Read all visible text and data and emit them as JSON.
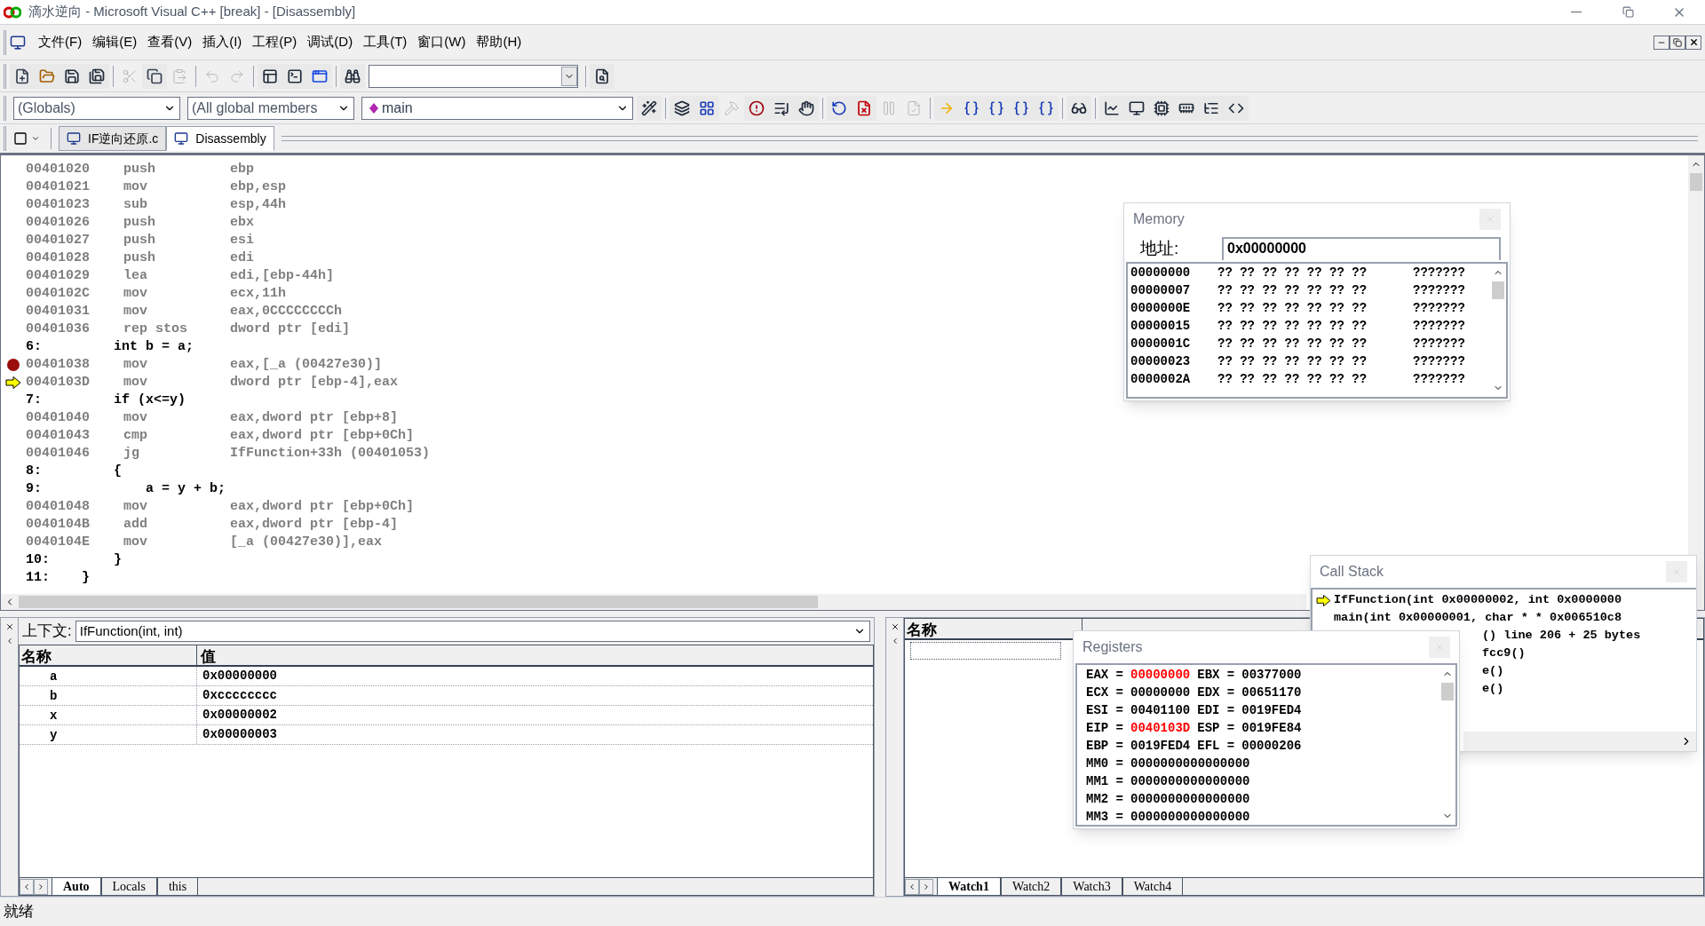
{
  "window": {
    "title": "滴水逆向 - Microsoft Visual C++ [break] - [Disassembly]"
  },
  "menu": [
    "文件(F)",
    "编辑(E)",
    "查看(V)",
    "插入(I)",
    "工程(P)",
    "调试(D)",
    "工具(T)",
    "窗口(W)",
    "帮助(H)"
  ],
  "toolbar_1": [
    {
      "kind": "new",
      "disabled": false
    },
    {
      "kind": "open",
      "disabled": false
    },
    {
      "kind": "save",
      "disabled": false
    },
    {
      "kind": "save-all",
      "disabled": false
    },
    {
      "kind": "sep"
    },
    {
      "kind": "cut",
      "disabled": true
    },
    {
      "kind": "copy",
      "disabled": false
    },
    {
      "kind": "paste",
      "disabled": true
    },
    {
      "kind": "sep"
    },
    {
      "kind": "undo",
      "disabled": true
    },
    {
      "kind": "redo",
      "disabled": true
    },
    {
      "kind": "sep"
    },
    {
      "kind": "workspace",
      "disabled": false
    },
    {
      "kind": "output",
      "disabled": false
    },
    {
      "kind": "windows",
      "disabled": false
    },
    {
      "kind": "sep"
    },
    {
      "kind": "find-files",
      "disabled": false
    },
    {
      "kind": "find-combo"
    },
    {
      "kind": "sep"
    },
    {
      "kind": "help-search",
      "disabled": false
    }
  ],
  "class_combo": {
    "value": "(Globals)"
  },
  "members_combo": {
    "value": "(All global members"
  },
  "function_combo": {
    "value": "main"
  },
  "toolbar_2": [
    {
      "kind": "wizard",
      "disabled": false
    },
    {
      "kind": "sep"
    },
    {
      "kind": "compile",
      "disabled": false
    },
    {
      "kind": "build",
      "disabled": false
    },
    {
      "kind": "stop",
      "disabled": true
    },
    {
      "kind": "execute",
      "disabled": false
    },
    {
      "kind": "breakpoint-list",
      "disabled": false
    },
    {
      "kind": "hand",
      "disabled": false
    },
    {
      "kind": "sep"
    },
    {
      "kind": "restart",
      "disabled": false
    },
    {
      "kind": "stop-debug",
      "disabled": false
    },
    {
      "kind": "break",
      "disabled": true
    },
    {
      "kind": "apply",
      "disabled": true
    },
    {
      "kind": "sep"
    },
    {
      "kind": "show-next",
      "disabled": false
    },
    {
      "kind": "step-into",
      "disabled": false
    },
    {
      "kind": "step-over",
      "disabled": false
    },
    {
      "kind": "step-out",
      "disabled": false
    },
    {
      "kind": "run-cursor",
      "disabled": false
    },
    {
      "kind": "sep"
    },
    {
      "kind": "quickwatch",
      "disabled": false
    },
    {
      "kind": "sep"
    },
    {
      "kind": "watch",
      "disabled": false
    },
    {
      "kind": "variables",
      "disabled": false
    },
    {
      "kind": "registers",
      "disabled": false
    },
    {
      "kind": "memory",
      "disabled": false
    },
    {
      "kind": "callstack",
      "disabled": false
    },
    {
      "kind": "disassembly",
      "disabled": false
    }
  ],
  "document_tabs": [
    {
      "label": "IF逆向还原.c",
      "selected": false
    },
    {
      "label": "Disassembly",
      "selected": true
    }
  ],
  "code_lines": [
    {
      "kind": "asm",
      "address": "00401020",
      "mnemonic": "push",
      "operands": "ebp",
      "breakpoint": false,
      "current": false
    },
    {
      "kind": "asm",
      "address": "00401021",
      "mnemonic": "mov",
      "operands": "ebp,esp",
      "breakpoint": false,
      "current": false
    },
    {
      "kind": "asm",
      "address": "00401023",
      "mnemonic": "sub",
      "operands": "esp,44h",
      "breakpoint": false,
      "current": false
    },
    {
      "kind": "asm",
      "address": "00401026",
      "mnemonic": "push",
      "operands": "ebx",
      "breakpoint": false,
      "current": false
    },
    {
      "kind": "asm",
      "address": "00401027",
      "mnemonic": "push",
      "operands": "esi",
      "breakpoint": false,
      "current": false
    },
    {
      "kind": "asm",
      "address": "00401028",
      "mnemonic": "push",
      "operands": "edi",
      "breakpoint": false,
      "current": false
    },
    {
      "kind": "asm",
      "address": "00401029",
      "mnemonic": "lea",
      "operands": "edi,[ebp-44h]",
      "breakpoint": false,
      "current": false
    },
    {
      "kind": "asm",
      "address": "0040102C",
      "mnemonic": "mov",
      "operands": "ecx,11h",
      "breakpoint": false,
      "current": false
    },
    {
      "kind": "asm",
      "address": "00401031",
      "mnemonic": "mov",
      "operands": "eax,0CCCCCCCCh",
      "breakpoint": false,
      "current": false
    },
    {
      "kind": "asm",
      "address": "00401036",
      "mnemonic": "rep stos",
      "operands": "dword ptr [edi]",
      "breakpoint": false,
      "current": false
    },
    {
      "kind": "source",
      "text": "6:         int b = a;"
    },
    {
      "kind": "asm",
      "address": "00401038",
      "mnemonic": "mov",
      "operands": "eax,[_a (00427e30)]",
      "breakpoint": true,
      "current": false
    },
    {
      "kind": "asm",
      "address": "0040103D",
      "mnemonic": "mov",
      "operands": "dword ptr [ebp-4],eax",
      "breakpoint": false,
      "current": true
    },
    {
      "kind": "source",
      "text": "7:         if (x<=y)"
    },
    {
      "kind": "asm",
      "address": "00401040",
      "mnemonic": "mov",
      "operands": "eax,dword ptr [ebp+8]",
      "breakpoint": false,
      "current": false
    },
    {
      "kind": "asm",
      "address": "00401043",
      "mnemonic": "cmp",
      "operands": "eax,dword ptr [ebp+0Ch]",
      "breakpoint": false,
      "current": false
    },
    {
      "kind": "asm",
      "address": "00401046",
      "mnemonic": "jg",
      "operands": "IfFunction+33h (00401053)",
      "breakpoint": false,
      "current": false
    },
    {
      "kind": "source",
      "text": "8:         {"
    },
    {
      "kind": "source",
      "text": "9:             a = y + b;"
    },
    {
      "kind": "asm",
      "address": "00401048",
      "mnemonic": "mov",
      "operands": "eax,dword ptr [ebp+0Ch]",
      "breakpoint": false,
      "current": false
    },
    {
      "kind": "asm",
      "address": "0040104B",
      "mnemonic": "add",
      "operands": "eax,dword ptr [ebp-4]",
      "breakpoint": false,
      "current": false
    },
    {
      "kind": "asm",
      "address": "0040104E",
      "mnemonic": "mov",
      "operands": "[_a (00427e30)],eax",
      "breakpoint": false,
      "current": false
    },
    {
      "kind": "source",
      "text": "10:        }"
    },
    {
      "kind": "source",
      "text": "11:    }"
    }
  ],
  "variables_pane": {
    "context_label": "上下文:",
    "context_value": "IfFunction(int, int)",
    "columns": [
      "名称",
      "值"
    ],
    "rows": [
      {
        "name": "a",
        "value": "0x00000000"
      },
      {
        "name": "b",
        "value": "0xcccccccc"
      },
      {
        "name": "x",
        "value": "0x00000002"
      },
      {
        "name": "y",
        "value": "0x00000003"
      }
    ],
    "tabs": [
      {
        "label": "Auto",
        "selected": true
      },
      {
        "label": "Locals",
        "selected": false
      },
      {
        "label": "this",
        "selected": false
      }
    ]
  },
  "watch_pane": {
    "columns": [
      "名称"
    ],
    "tabs": [
      {
        "label": "Watch1",
        "selected": true
      },
      {
        "label": "Watch2",
        "selected": false
      },
      {
        "label": "Watch3",
        "selected": false
      },
      {
        "label": "Watch4",
        "selected": false
      }
    ]
  },
  "memory_window": {
    "title": "Memory",
    "address_label": "地址:",
    "address_value": "0x00000000",
    "rows": [
      {
        "address": "00000000",
        "bytes": "?? ?? ?? ?? ?? ?? ??",
        "ascii": "???????"
      },
      {
        "address": "00000007",
        "bytes": "?? ?? ?? ?? ?? ?? ??",
        "ascii": "???????"
      },
      {
        "address": "0000000E",
        "bytes": "?? ?? ?? ?? ?? ?? ??",
        "ascii": "???????"
      },
      {
        "address": "00000015",
        "bytes": "?? ?? ?? ?? ?? ?? ??",
        "ascii": "???????"
      },
      {
        "address": "0000001C",
        "bytes": "?? ?? ?? ?? ?? ?? ??",
        "ascii": "???????"
      },
      {
        "address": "00000023",
        "bytes": "?? ?? ?? ?? ?? ?? ??",
        "ascii": "???????"
      },
      {
        "address": "0000002A",
        "bytes": "?? ?? ?? ?? ?? ?? ??",
        "ascii": "???????"
      }
    ]
  },
  "call_stack_window": {
    "title": "Call Stack",
    "frames": [
      {
        "text": "IfFunction(int 0x00000002, int 0x0000000",
        "current": true,
        "kind": "full"
      },
      {
        "text": "main(int 0x00000001, char * * 0x006510c8",
        "current": false,
        "kind": "full"
      },
      {
        "text": "() line 206 + 25 bytes",
        "current": false,
        "kind": "partial"
      },
      {
        "text": "fcc9()",
        "current": false,
        "kind": "partial"
      },
      {
        "text": "e()",
        "current": false,
        "kind": "partial"
      },
      {
        "text": "e()",
        "current": false,
        "kind": "partial"
      }
    ]
  },
  "registers_window": {
    "title": "Registers",
    "rows": [
      [
        {
          "label": "EAX =",
          "value": "00000000",
          "changed": true
        },
        {
          "label": "EBX =",
          "value": "00377000",
          "changed": false
        }
      ],
      [
        {
          "label": "ECX =",
          "value": "00000000",
          "changed": false
        },
        {
          "label": "EDX =",
          "value": "00651170",
          "changed": false
        }
      ],
      [
        {
          "label": "ESI =",
          "value": "00401100",
          "changed": false
        },
        {
          "label": "EDI =",
          "value": "0019FED4",
          "changed": false
        }
      ],
      [
        {
          "label": "EIP =",
          "value": "0040103D",
          "changed": true
        },
        {
          "label": "ESP =",
          "value": "0019FE84",
          "changed": false
        }
      ],
      [
        {
          "label": "EBP =",
          "value": "0019FED4",
          "changed": false
        },
        {
          "label": "EFL =",
          "value": "00000206",
          "changed": false
        }
      ],
      [
        {
          "label": "MM0 =",
          "value": "0000000000000000",
          "changed": false
        }
      ],
      [
        {
          "label": "MM1 =",
          "value": "0000000000000000",
          "changed": false
        }
      ],
      [
        {
          "label": "MM2 =",
          "value": "0000000000000000",
          "changed": false
        }
      ],
      [
        {
          "label": "MM3 =",
          "value": "0000000000000000",
          "changed": false
        }
      ]
    ]
  },
  "status_bar": {
    "text": "就绪"
  }
}
